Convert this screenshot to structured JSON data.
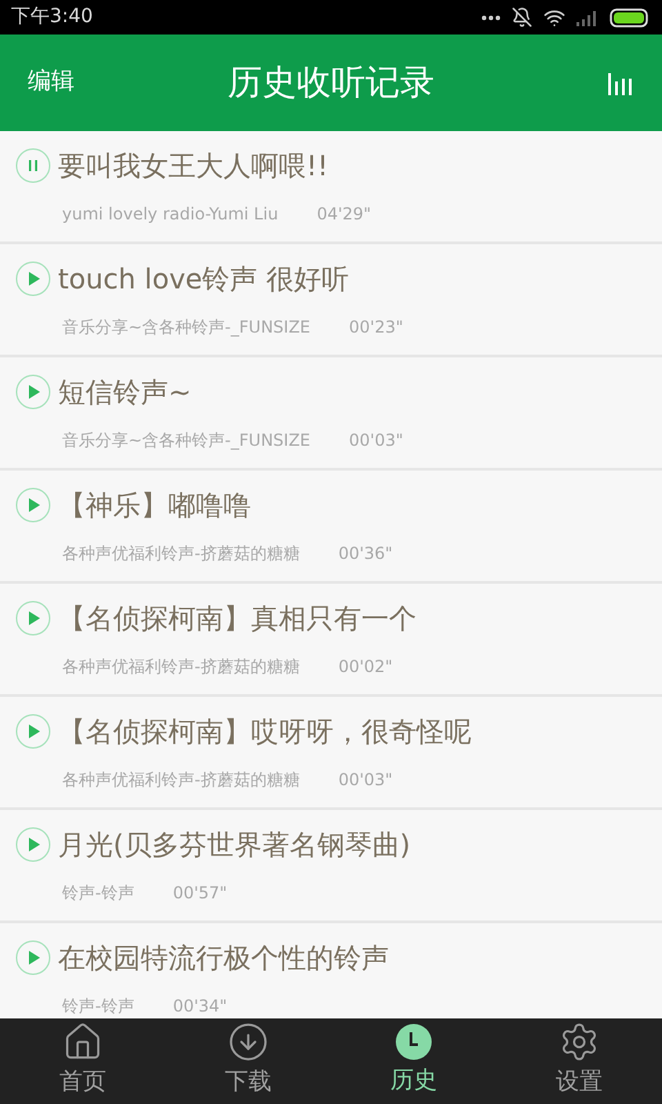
{
  "status_bar": {
    "time": "下午3:40"
  },
  "header": {
    "edit": "编辑",
    "title": "历史收听记录"
  },
  "tracks": [
    {
      "title": "要叫我女王大人啊喂!!",
      "source": "yumi lovely radio-Yumi Liu",
      "duration": "04'29\"",
      "playing": true
    },
    {
      "title": "touch love铃声 很好听",
      "source": "音乐分享~含各种铃声-_FUNSIZE",
      "duration": "00'23\"",
      "playing": false
    },
    {
      "title": "短信铃声~",
      "source": "音乐分享~含各种铃声-_FUNSIZE",
      "duration": "00'03\"",
      "playing": false
    },
    {
      "title": "【神乐】嘟噜噜",
      "source": "各种声优福利铃声-挤蘑菇的糖糖",
      "duration": "00'36\"",
      "playing": false
    },
    {
      "title": "【名侦探柯南】真相只有一个",
      "source": "各种声优福利铃声-挤蘑菇的糖糖",
      "duration": "00'02\"",
      "playing": false
    },
    {
      "title": "【名侦探柯南】哎呀呀，很奇怪呢",
      "source": "各种声优福利铃声-挤蘑菇的糖糖",
      "duration": "00'03\"",
      "playing": false
    },
    {
      "title": "月光(贝多芬世界著名钢琴曲)",
      "source": "铃声-铃声",
      "duration": "00'57\"",
      "playing": false
    },
    {
      "title": "在校园特流行极个性的铃声",
      "source": "铃声-铃声",
      "duration": "00'34\"",
      "playing": false
    }
  ],
  "tabs": [
    {
      "kind": "home",
      "label": "首页",
      "selected": false
    },
    {
      "kind": "download",
      "label": "下载",
      "selected": false
    },
    {
      "kind": "history",
      "label": "历史",
      "selected": true
    },
    {
      "kind": "settings",
      "label": "设置",
      "selected": false
    }
  ]
}
